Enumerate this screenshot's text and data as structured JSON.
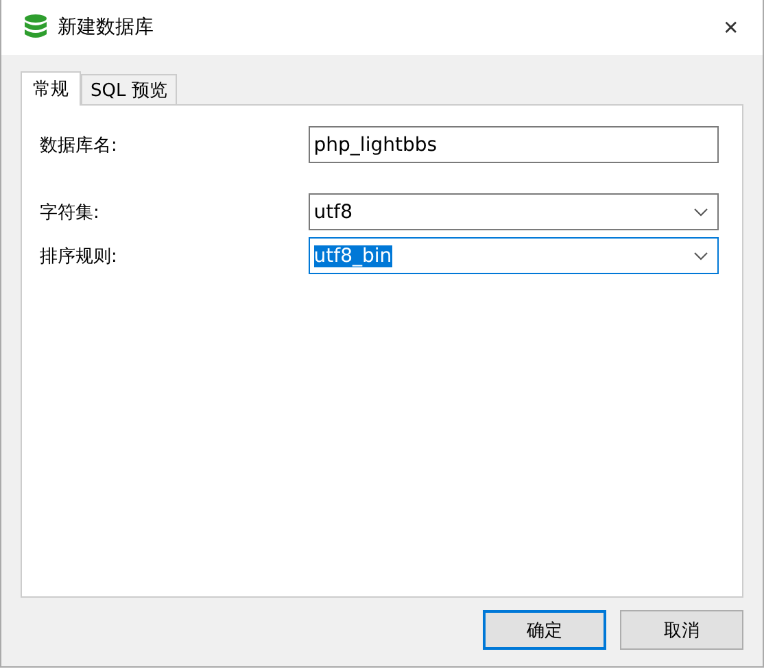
{
  "window": {
    "title": "新建数据库",
    "close": "✕"
  },
  "tabs": [
    {
      "label": "常规",
      "selected": true
    },
    {
      "label": "SQL 预览",
      "selected": false
    }
  ],
  "fields": [
    {
      "label": "数据库名:",
      "kind": "input",
      "value": "php_lightbbs",
      "focused": false
    },
    {
      "label": "字符集:",
      "kind": "select",
      "value": "utf8",
      "focused": false
    },
    {
      "label": "排序规则:",
      "kind": "select",
      "value": "utf8_bin",
      "focused": true
    }
  ],
  "buttons": [
    {
      "label": "确定",
      "default": true
    },
    {
      "label": "取消",
      "default": false
    }
  ]
}
